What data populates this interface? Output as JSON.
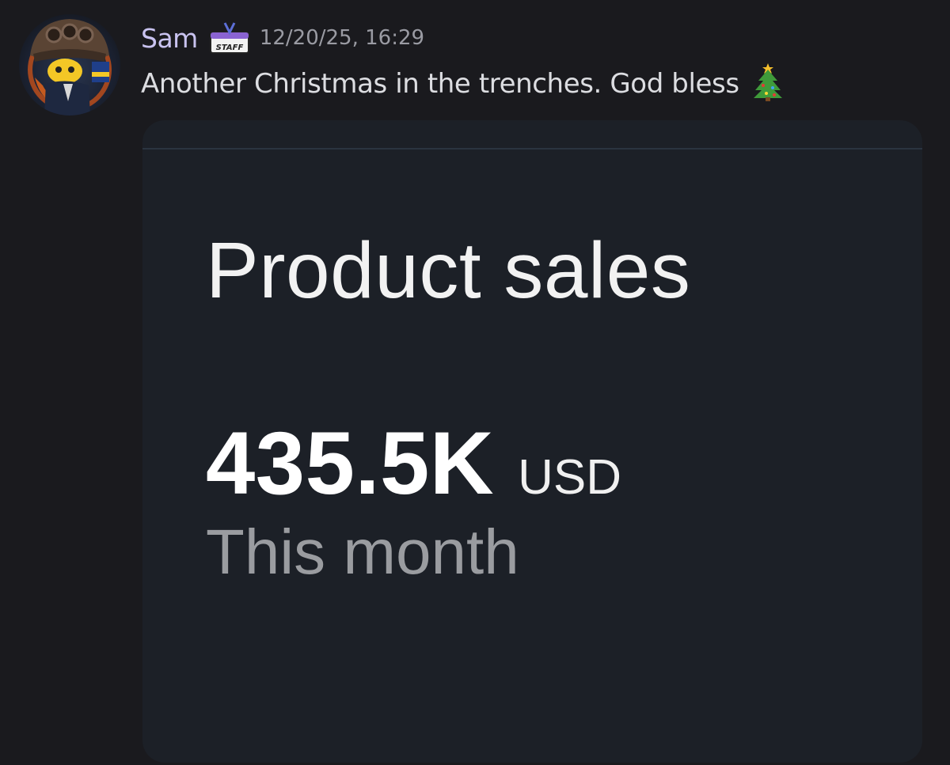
{
  "message": {
    "author": "Sam",
    "badge_icon": "staff-badge-icon",
    "timestamp": "12/20/25, 16:29",
    "text": "Another Christmas in the trenches. God bless",
    "emoji": "christmas-tree-icon",
    "colors": {
      "username": "#c9c3f0",
      "timestamp": "#9a9ba3",
      "text": "#dcdde1",
      "background": "#1a1a1e"
    }
  },
  "attachment": {
    "title": "Product sales",
    "value": "435.5K",
    "unit": "USD",
    "period": "This month",
    "colors": {
      "card_background": "#1c2027",
      "value": "#ffffff",
      "period": "#9a9ca0"
    }
  }
}
